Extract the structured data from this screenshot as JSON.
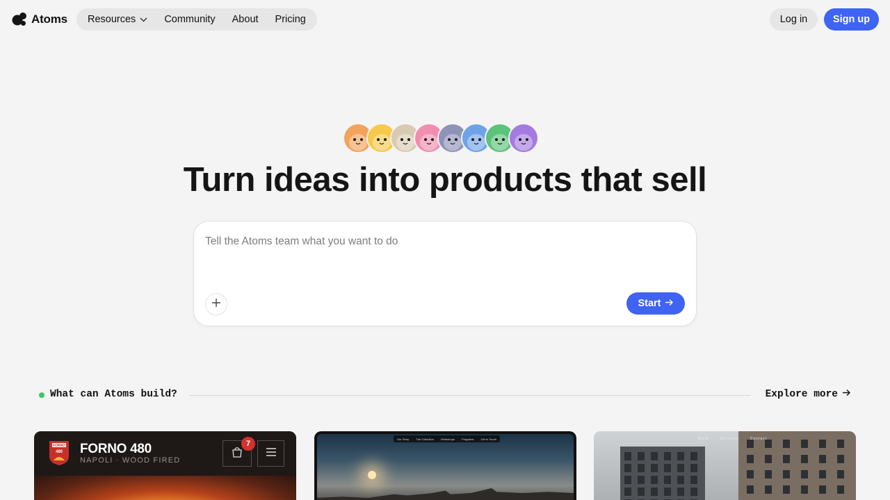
{
  "brand": {
    "name": "Atoms"
  },
  "nav": {
    "items": [
      {
        "label": "Resources",
        "has_dropdown": true
      },
      {
        "label": "Community"
      },
      {
        "label": "About"
      },
      {
        "label": "Pricing"
      }
    ],
    "login_label": "Log in",
    "signup_label": "Sign up"
  },
  "hero": {
    "avatar_colors": [
      "#f3a35c",
      "#f6c94a",
      "#d9cbb3",
      "#f28db0",
      "#8f93b8",
      "#6fa3e8",
      "#5cc37a",
      "#a57be0"
    ],
    "headline": "Turn ideas into products that sell"
  },
  "prompt": {
    "placeholder": "Tell the Atoms team what you want to do",
    "start_label": "Start"
  },
  "showcase": {
    "title": "What can Atoms build?",
    "explore_label": "Explore more",
    "cards": [
      {
        "name": "FORNO 480",
        "subtitle": "NAPOLI · WOOD FIRED",
        "logo_text_top": "FORNO",
        "logo_text_bottom": "480",
        "cart_count": "7"
      },
      {
        "nav": [
          "Our Story",
          "The Collection",
          "Workshops",
          "Programs",
          "Get in Touch"
        ]
      },
      {
        "nav": [
          "Work",
          "Services",
          "Contact"
        ]
      }
    ]
  },
  "colors": {
    "accent": "#3f63f2",
    "background": "#f4f4f4",
    "status_dot": "#3fc46b",
    "badge": "#d4322c"
  },
  "icons": [
    "atoms-logo-icon",
    "chevron-down-icon",
    "plus-icon",
    "arrow-right-icon",
    "cart-icon",
    "menu-icon"
  ]
}
